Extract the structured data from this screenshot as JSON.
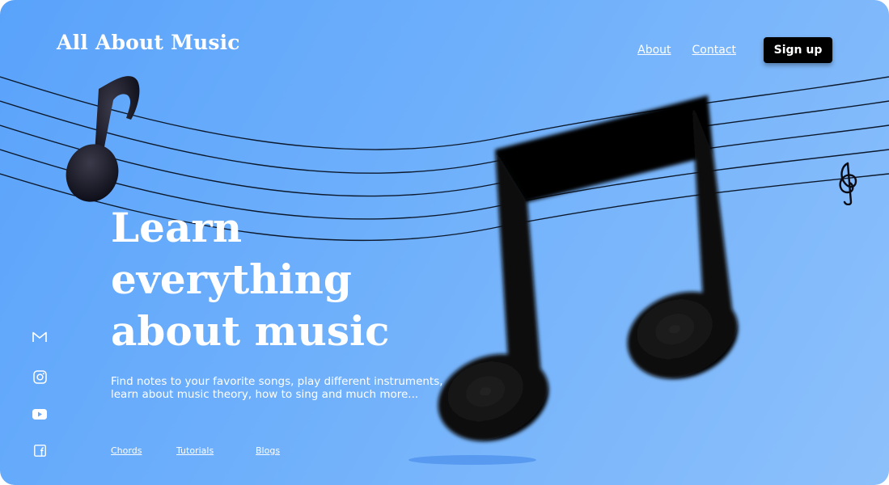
{
  "brand": {
    "logo_text": "All About Music"
  },
  "nav": {
    "about_label": "About",
    "contact_label": "Contact",
    "signup_label": "Sign up"
  },
  "hero": {
    "title_line1": "Learn",
    "title_line2": "everything",
    "title_line3": "about music",
    "description_line1": "Find notes to your favorite songs, play different instruments,",
    "description_line2": "learn about music theory, how to sing and much more..."
  },
  "footer_links": {
    "chords": "Chords",
    "tutorials": "Tutorials",
    "blogs": "Blogs"
  },
  "social": [
    "gmail-icon",
    "instagram-icon",
    "youtube-icon",
    "facebook-icon"
  ],
  "colors": {
    "background_start": "#5aa3fb",
    "background_end": "#8cc0fb",
    "text": "#ffffff",
    "button": "#000000"
  }
}
